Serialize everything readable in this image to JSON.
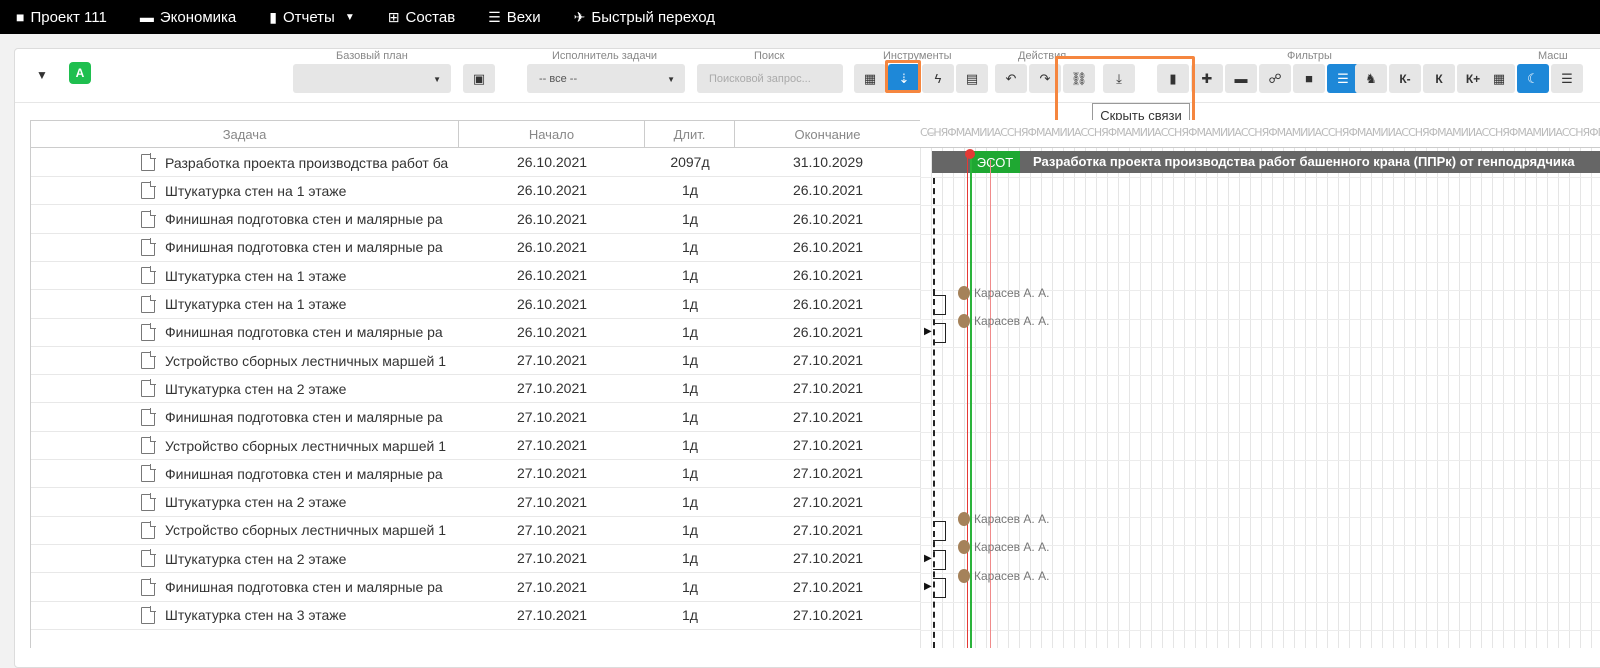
{
  "nav": [
    {
      "icon": "briefcase-icon",
      "glyph": "■",
      "label": "Проект 111"
    },
    {
      "icon": "money-icon",
      "glyph": "▬",
      "label": "Экономика"
    },
    {
      "icon": "clipboard-icon",
      "glyph": "▮",
      "label": "Отчеты",
      "has_dropdown": true
    },
    {
      "icon": "sitemap-icon",
      "glyph": "⊞",
      "label": "Состав"
    },
    {
      "icon": "list-icon",
      "glyph": "☰",
      "label": "Вехи"
    },
    {
      "icon": "plane-icon",
      "glyph": "✈",
      "label": "Быстрый переход"
    }
  ],
  "toolbar": {
    "badge": "A",
    "groups": {
      "baseline": "Базовый план",
      "assignee": "Исполнитель задачи",
      "search": "Поиск",
      "tools": "Инструменты",
      "actions": "Действия",
      "filters": "Фильтры",
      "scale": "Масш"
    },
    "assignee_value": "-- все --",
    "search_placeholder": "Поисковой запрос...",
    "scale_buttons": [
      "К-",
      "К",
      "К+"
    ],
    "tooltip": "Скрыть связи"
  },
  "grid": {
    "headers": {
      "task": "Задача",
      "start": "Начало",
      "duration": "Длит.",
      "end": "Окончание"
    },
    "rows": [
      {
        "task": "Разработка проекта производства работ ба",
        "start": "26.10.2021",
        "duration": "2097д",
        "end": "31.10.2029"
      },
      {
        "task": "Штукатурка стен на 1 этаже",
        "start": "26.10.2021",
        "duration": "1д",
        "end": "26.10.2021"
      },
      {
        "task": "Финишная подготовка стен и малярные ра",
        "start": "26.10.2021",
        "duration": "1д",
        "end": "26.10.2021"
      },
      {
        "task": "Финишная подготовка стен и малярные ра",
        "start": "26.10.2021",
        "duration": "1д",
        "end": "26.10.2021"
      },
      {
        "task": "Штукатурка стен на 1 этаже",
        "start": "26.10.2021",
        "duration": "1д",
        "end": "26.10.2021"
      },
      {
        "task": "Штукатурка стен на 1 этаже",
        "start": "26.10.2021",
        "duration": "1д",
        "end": "26.10.2021"
      },
      {
        "task": "Финишная подготовка стен и малярные ра",
        "start": "26.10.2021",
        "duration": "1д",
        "end": "26.10.2021"
      },
      {
        "task": "Устройство сборных лестничных маршей 1",
        "start": "27.10.2021",
        "duration": "1д",
        "end": "27.10.2021"
      },
      {
        "task": "Штукатурка стен на 2 этаже",
        "start": "27.10.2021",
        "duration": "1д",
        "end": "27.10.2021"
      },
      {
        "task": "Финишная подготовка стен и малярные ра",
        "start": "27.10.2021",
        "duration": "1д",
        "end": "27.10.2021"
      },
      {
        "task": "Устройство сборных лестничных маршей 1",
        "start": "27.10.2021",
        "duration": "1д",
        "end": "27.10.2021"
      },
      {
        "task": "Финишная подготовка стен и малярные ра",
        "start": "27.10.2021",
        "duration": "1д",
        "end": "27.10.2021"
      },
      {
        "task": "Штукатурка стен на 2 этаже",
        "start": "27.10.2021",
        "duration": "1д",
        "end": "27.10.2021"
      },
      {
        "task": "Устройство сборных лестничных маршей 1",
        "start": "27.10.2021",
        "duration": "1д",
        "end": "27.10.2021"
      },
      {
        "task": "Штукатурка стен на 2 этаже",
        "start": "27.10.2021",
        "duration": "1д",
        "end": "27.10.2021"
      },
      {
        "task": "Финишная подготовка стен и малярные ра",
        "start": "27.10.2021",
        "duration": "1д",
        "end": "27.10.2021"
      },
      {
        "task": "Штукатурка стен на 3 этаже",
        "start": "27.10.2021",
        "duration": "1д",
        "end": "27.10.2021"
      }
    ]
  },
  "gantt": {
    "scale_text": "СС̶НЯФМАМИИАССНЯФМАМИИАССНЯФМАМИИАССНЯФМАМИИАССНЯФМАМИИАССНЯФМАМИИАССНЯФМАМИИАССНЯФМАМИИАССНЯФМАМИИАСС",
    "summary_label": "Разработка проекта производства работ башенного крана (ППРк) от генподрядчика",
    "esot_label": "ЭСОТ",
    "assignees": [
      "Карасев А. А.",
      "Карасев А. А.",
      "Карасев А. А.",
      "Карасев А. А.",
      "Карасев А. А."
    ]
  },
  "colors": {
    "accent": "#1e88d8",
    "highlight": "#f5863f",
    "green": "#1fa832",
    "red": "#e53935"
  }
}
